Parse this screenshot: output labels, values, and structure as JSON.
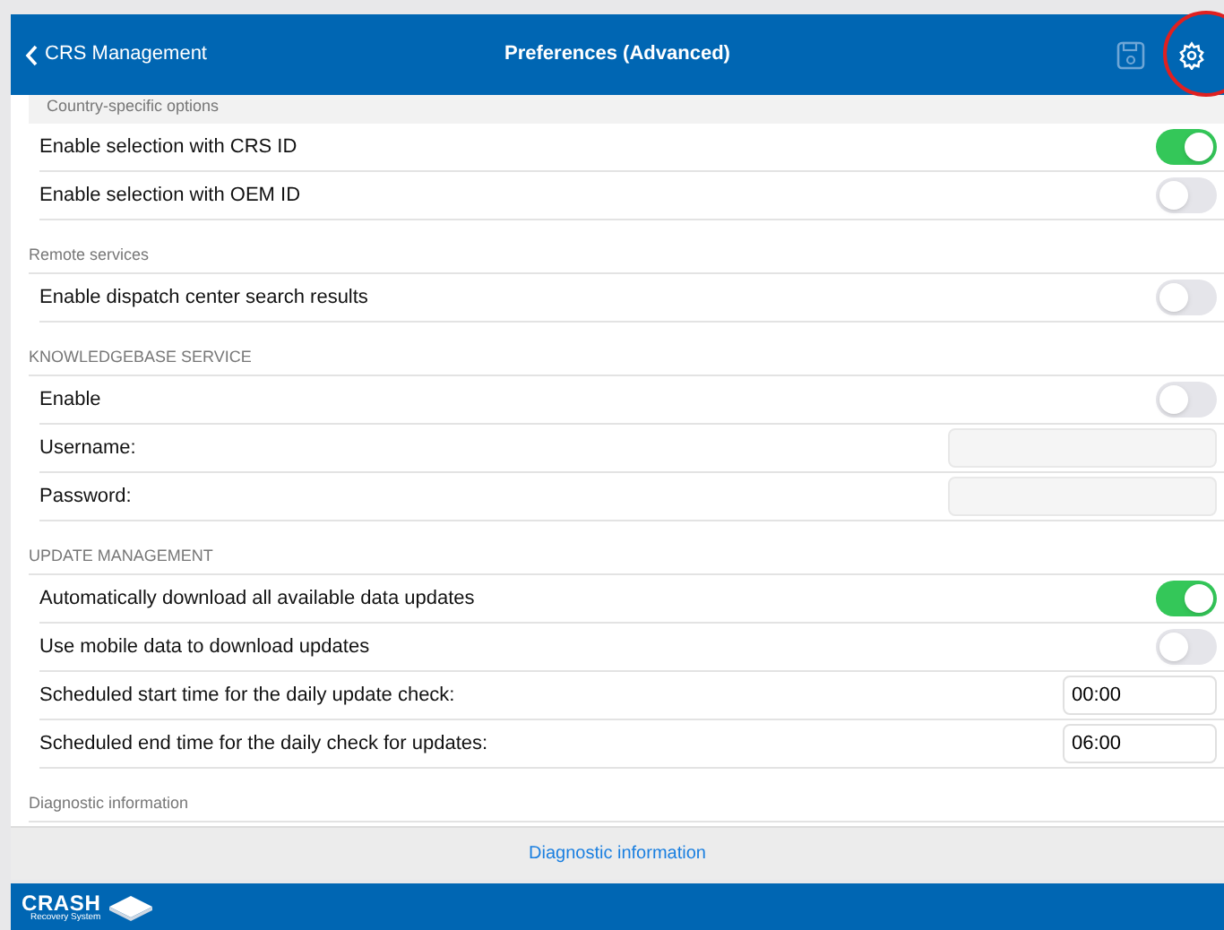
{
  "header": {
    "back_label": "CRS Management",
    "title": "Preferences (Advanced)"
  },
  "sections": [
    {
      "title": "Country-specific options",
      "rows": [
        {
          "kind": "toggle",
          "label": "Enable selection with CRS ID",
          "on": true
        },
        {
          "kind": "toggle",
          "label": "Enable selection with OEM ID",
          "on": false
        }
      ]
    },
    {
      "title": "Remote services",
      "rows": [
        {
          "kind": "toggle",
          "label": "Enable dispatch center search results",
          "on": false
        }
      ]
    },
    {
      "title": "KNOWLEDGEBASE SERVICE",
      "rows": [
        {
          "kind": "toggle",
          "label": "Enable",
          "on": false
        },
        {
          "kind": "field",
          "label": "Username:"
        },
        {
          "kind": "field",
          "label": "Password:"
        }
      ]
    },
    {
      "title": "UPDATE MANAGEMENT",
      "rows": [
        {
          "kind": "toggle",
          "label": "Automatically download all available data updates",
          "on": true
        },
        {
          "kind": "toggle",
          "label": "Use mobile data to download updates",
          "on": false
        },
        {
          "kind": "time",
          "label": "Scheduled start time for the daily update check:",
          "value": "00:00"
        },
        {
          "kind": "time",
          "label": "Scheduled end time for the daily check for updates:",
          "value": "06:00"
        }
      ]
    },
    {
      "title": "Diagnostic information"
    }
  ],
  "action": {
    "label": "Diagnostic information"
  },
  "footer": {
    "logo": "CRASH",
    "tagline": "Recovery System"
  }
}
